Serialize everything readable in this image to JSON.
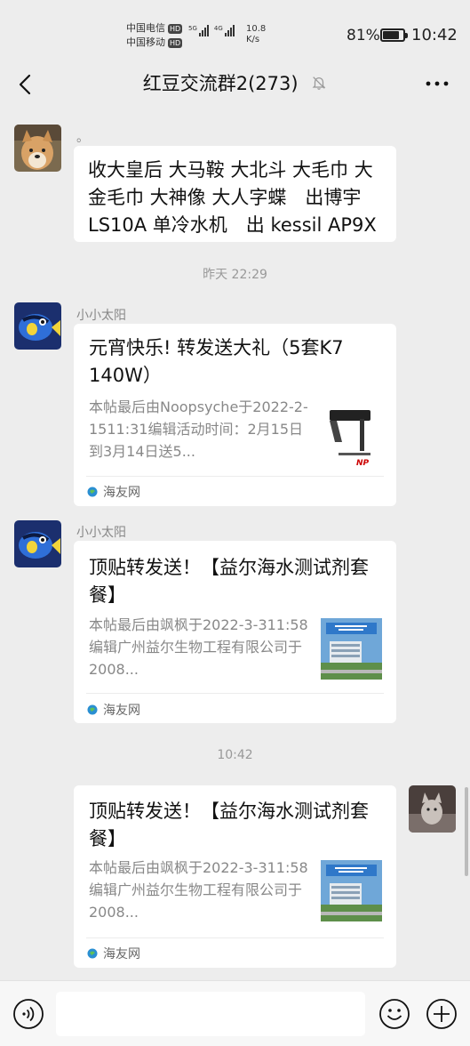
{
  "status": {
    "carrier1": "中国电信",
    "carrier2": "中国移动",
    "hd": "HD",
    "net1": "5G",
    "net2": "4G",
    "speed_value": "10.8",
    "speed_unit": "K/s",
    "battery": "81%",
    "battery_level": 0.81,
    "time": "10:42"
  },
  "header": {
    "title": "红豆交流群2(273)",
    "back_icon": "chevron-left-icon",
    "mute_icon": "bell-off-icon",
    "more_icon": "more-horizontal-icon"
  },
  "messages": [
    {
      "sender": "。",
      "text": "收大皇后 大马鞍 大北斗 大毛巾 大金毛巾 大神像 大人字蝶　出博宇LS10A 单冷水机　出 kessil AP9X"
    },
    {
      "time": "昨天 22:29"
    },
    {
      "sender": "小小太阳",
      "title": "元宵快乐! 转发送大礼（5套K7 140W）",
      "desc": "本帖最后由Noopsyche于2022-2-1511:31编辑活动时间：2月15日到3月14日送5...",
      "source": "海友网"
    },
    {
      "sender": "小小太阳",
      "title": "顶贴转发送！【益尔海水测试剂套餐】",
      "desc": "本帖最后由飒枫于2022-3-311:58编辑广州益尔生物工程有限公司于2008...",
      "source": "海友网"
    },
    {
      "time": "10:42"
    },
    {
      "title": "顶贴转发送！【益尔海水测试剂套餐】",
      "desc": "本帖最后由飒枫于2022-3-311:58编辑广州益尔生物工程有限公司于2008...",
      "source": "海友网"
    }
  ],
  "input": {
    "placeholder": "",
    "voice_icon": "voice-icon",
    "emoji_icon": "emoji-icon",
    "plus_icon": "plus-icon"
  }
}
